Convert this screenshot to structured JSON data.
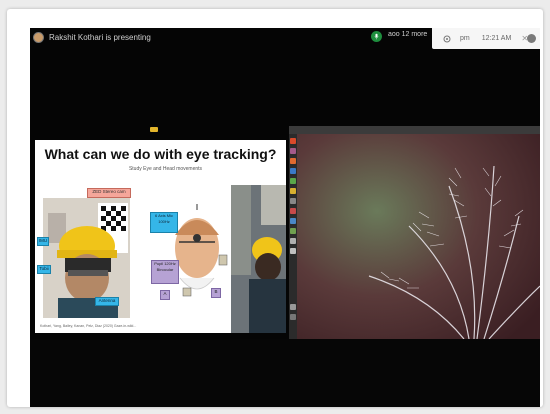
{
  "meeting": {
    "presenter_text": "Rakshit Kothari is presenting",
    "viewer_name": "aoo 12 more"
  },
  "statusbar": {
    "period": "pm",
    "time": "12:21 AM",
    "close": "✕"
  },
  "slide": {
    "title": "What can we do with eye tracking?",
    "subtitle": "Study Eye and Head movements",
    "labels": {
      "stereo_cam": "ZED Stereo cam",
      "imu": "IMU",
      "tobii": "Tobii",
      "antenna": "Antenna",
      "eyetracker": "6 Axis Mic 100Hz",
      "pupil": "Pupil 120Hz Binocular",
      "small_a": "A",
      "small_b": "B"
    },
    "footer": "Kothari, Yang, Bailey, Kanan, Pelz, Diaz (2020) Gaze-in-wild..."
  },
  "colors": {
    "meet_bg": "#050505",
    "mic_green": "#1e8e3e",
    "slide_pink": "#f5a69a",
    "slide_blue": "#35b6e8",
    "slide_purple": "#b6a2d4"
  },
  "icons": [
    "avatar",
    "mic-icon",
    "gear-icon",
    "close-icon",
    "user-icon",
    "launcher-icons"
  ]
}
